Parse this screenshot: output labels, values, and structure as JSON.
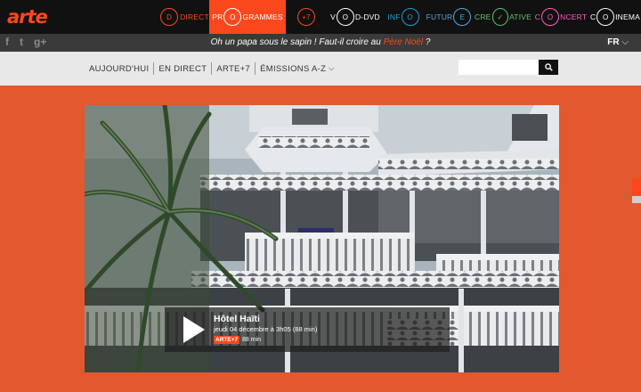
{
  "logo": "arte",
  "nav": [
    {
      "label": "DIRECT",
      "icon": "D",
      "color": "#fa481c"
    },
    {
      "label": "GRAMMES",
      "prefix": "PR",
      "icon": "O",
      "color": "#ffffff",
      "active": true
    },
    {
      "label": "",
      "icon": "+7",
      "color": "#fa481c"
    },
    {
      "label": "D-DVD",
      "prefix": "V",
      "icon": "O",
      "color": "#ffffff"
    },
    {
      "label": "INF",
      "icon": "O",
      "color": "#1e9bd7"
    },
    {
      "label": "FUTUR",
      "icon": "E",
      "color": "#4fa8e0"
    },
    {
      "label": "ATIVE",
      "prefix": "CRE",
      "icon": "✓",
      "color": "#63c46d"
    },
    {
      "label": "NCERT",
      "prefix": "C",
      "icon": "O",
      "color": "#ff5cbe"
    },
    {
      "label": "INEMA",
      "prefix": "C",
      "icon": "O",
      "color": "#ffffff"
    }
  ],
  "strip": {
    "message_part1": "Oh un papa sous le sapin ! Faut-il croire au ",
    "message_highlight": "Père Noël",
    "message_part2": " ?",
    "lang": "FR"
  },
  "social": {
    "facebook": "f",
    "twitter": "t",
    "google": "g+"
  },
  "subnav": {
    "items": [
      "AUJOURD'HUI",
      "EN DIRECT",
      "ARTE+7",
      "ÉMISSIONS A-Z"
    ],
    "search_placeholder": ""
  },
  "hero": {
    "title": "Hôtel Haïti",
    "date": "jeudi 04 décembre à 3h05 (88 min)",
    "badge": "ARTE+7",
    "duration": "88 min"
  },
  "colors": {
    "accent": "#fa481c",
    "bg": "#e2582f"
  }
}
